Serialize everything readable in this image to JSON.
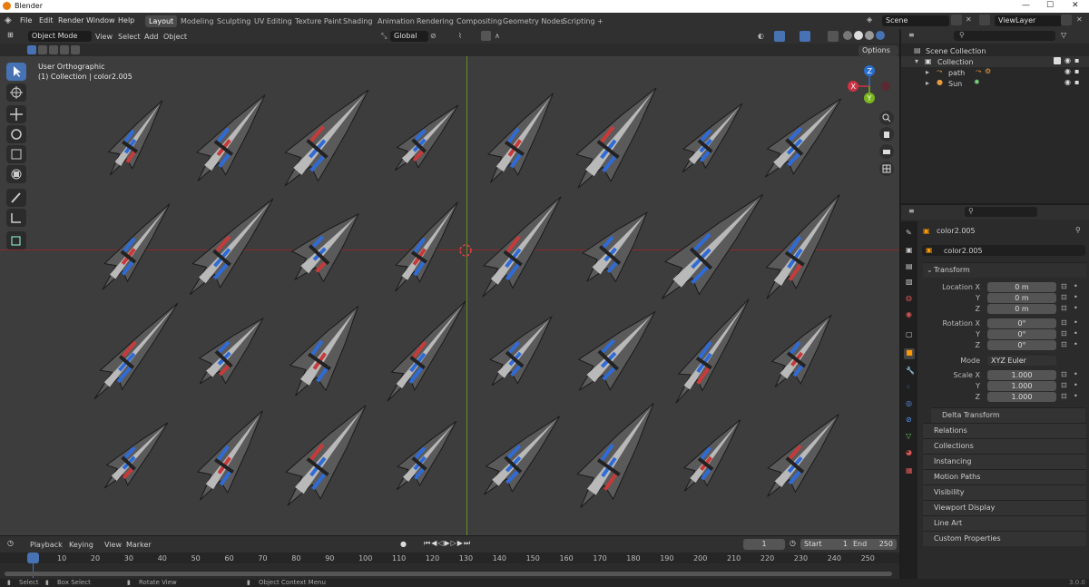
{
  "window": {
    "title": "Blender"
  },
  "menu": [
    "File",
    "Edit",
    "Render",
    "Window",
    "Help"
  ],
  "workspaces": [
    "Layout",
    "Modeling",
    "Sculpting",
    "UV Editing",
    "Texture Paint",
    "Shading",
    "Animation",
    "Rendering",
    "Compositing",
    "Geometry Nodes",
    "Scripting"
  ],
  "scene": "Scene",
  "viewlayer": "ViewLayer",
  "viewport": {
    "mode": "Object Mode",
    "menus": [
      "View",
      "Select",
      "Add",
      "Object"
    ],
    "orientation": "Global",
    "options": "Options",
    "view_name": "User Orthographic",
    "object_info": "(1) Collection | color2.005"
  },
  "outliner": {
    "root": "Scene Collection",
    "collection": "Collection",
    "items": [
      "path",
      "Sun"
    ]
  },
  "properties": {
    "object_name": "color2.005",
    "data_name": "color2.005",
    "transform": "Transform",
    "location": {
      "label": "Location X",
      "x": "0 m",
      "y": "0 m",
      "z": "0 m"
    },
    "rotation": {
      "label": "Rotation X",
      "x": "0°",
      "y": "0°",
      "z": "0°"
    },
    "mode_label": "Mode",
    "mode_value": "XYZ Euler",
    "scale": {
      "label": "Scale X",
      "x": "1.000",
      "y": "1.000",
      "z": "1.000"
    },
    "axis_y": "Y",
    "axis_z": "Z",
    "delta": "Delta Transform",
    "panels": [
      "Relations",
      "Collections",
      "Instancing",
      "Motion Paths",
      "Visibility",
      "Viewport Display",
      "Line Art",
      "Custom Properties"
    ]
  },
  "timeline": {
    "menus": [
      "Playback",
      "Keying",
      "View",
      "Marker"
    ],
    "current_frame": "1",
    "start_label": "Start",
    "start": "1",
    "end_label": "End",
    "end": "250",
    "ticks": [
      "1",
      "10",
      "20",
      "30",
      "40",
      "50",
      "60",
      "70",
      "80",
      "90",
      "100",
      "110",
      "120",
      "130",
      "140",
      "150",
      "160",
      "170",
      "180",
      "190",
      "200",
      "210",
      "220",
      "230",
      "240",
      "250"
    ]
  },
  "statusbar": {
    "items": [
      "Select",
      "Box Select",
      "Rotate View",
      "Object Context Menu"
    ],
    "version": "3.0.0"
  }
}
